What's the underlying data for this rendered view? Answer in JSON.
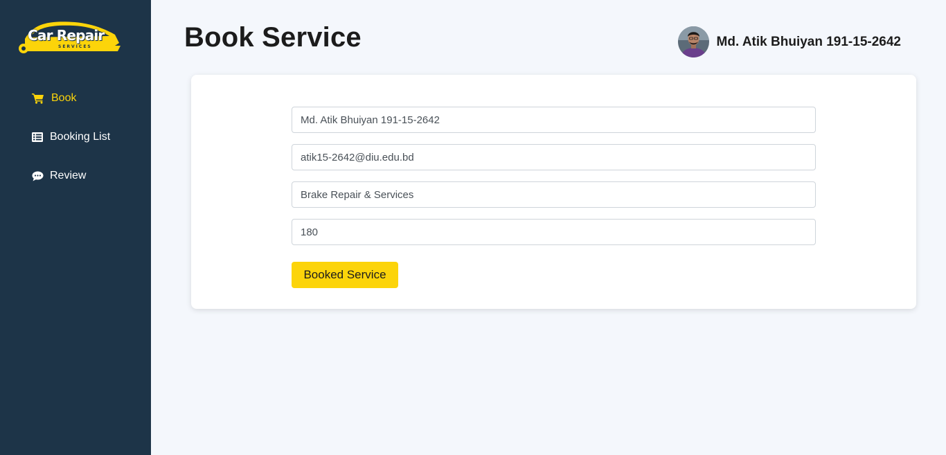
{
  "brand": {
    "name": "Car Repair",
    "tagline": "SERVICES"
  },
  "sidebar": {
    "items": [
      {
        "label": "Book",
        "icon": "cart-icon",
        "active": true
      },
      {
        "label": "Booking List",
        "icon": "list-icon",
        "active": false
      },
      {
        "label": "Review",
        "icon": "comment-icon",
        "active": false
      }
    ]
  },
  "header": {
    "title": "Book Service",
    "user_name": "Md. Atik Bhuiyan 191-15-2642"
  },
  "form": {
    "name_value": "Md. Atik Bhuiyan 191-15-2642",
    "email_value": "atik15-2642@diu.edu.bd",
    "service_value": "Brake Repair & Services",
    "price_value": "180",
    "submit_label": "Booked Service"
  },
  "colors": {
    "sidebar_bg": "#1d3448",
    "accent": "#fcd40a",
    "page_bg": "#f4f7fc"
  }
}
